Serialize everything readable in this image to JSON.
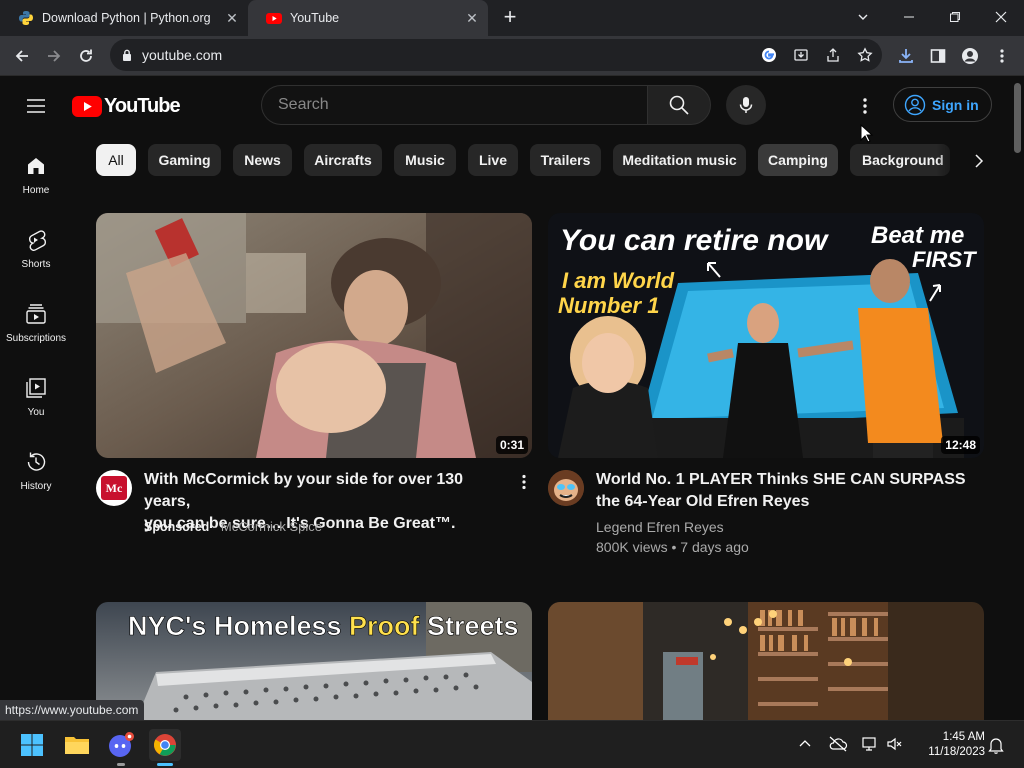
{
  "browser": {
    "tabs": [
      {
        "title": "Download Python | Python.org",
        "icon": "python-icon"
      },
      {
        "title": "YouTube",
        "icon": "youtube-icon"
      }
    ],
    "url": "youtube.com",
    "status_url": "https://www.youtube.com"
  },
  "header": {
    "logo_text": "YouTube",
    "search_placeholder": "Search",
    "sign_in_label": "Sign in"
  },
  "sidebar": {
    "items": [
      {
        "label": "Home",
        "icon": "home-icon"
      },
      {
        "label": "Shorts",
        "icon": "shorts-icon"
      },
      {
        "label": "Subscriptions",
        "icon": "subscriptions-icon"
      },
      {
        "label": "You",
        "icon": "you-icon"
      },
      {
        "label": "History",
        "icon": "history-icon"
      }
    ]
  },
  "chips": [
    "All",
    "Gaming",
    "News",
    "Aircrafts",
    "Music",
    "Live",
    "Trailers",
    "Meditation music",
    "Camping",
    "Background"
  ],
  "videos": [
    {
      "title_line1": "With McCormick by your side for over 130 years,",
      "title_line2": "you can be sure… It's Gonna Be Great™.",
      "duration": "0:31",
      "sponsored": "Sponsored",
      "channel": "McCormick Spice",
      "avatar_text": "Mc"
    },
    {
      "title_line1": "World No. 1 PLAYER Thinks SHE CAN SURPASS",
      "title_line2": "the 64-Year Old Efren Reyes",
      "duration": "12:48",
      "channel": "Legend Efren Reyes",
      "stats": "800K views • 7 days ago",
      "thumb_text_1": "You can retire now",
      "thumb_text_2": "Beat me",
      "thumb_text_3": "FIRST",
      "thumb_text_4": "I am World",
      "thumb_text_5": "Number 1"
    },
    {
      "thumb_text_a": "NYC's Homeless ",
      "thumb_text_b": "Proof",
      "thumb_text_c": " Streets"
    }
  ],
  "taskbar": {
    "time": "1:45 AM",
    "date": "11/18/2023"
  },
  "colors": {
    "youtube_red": "#ff0000",
    "link_blue": "#3ea6ff",
    "background": "#0f0f0f",
    "chip": "#272727"
  }
}
